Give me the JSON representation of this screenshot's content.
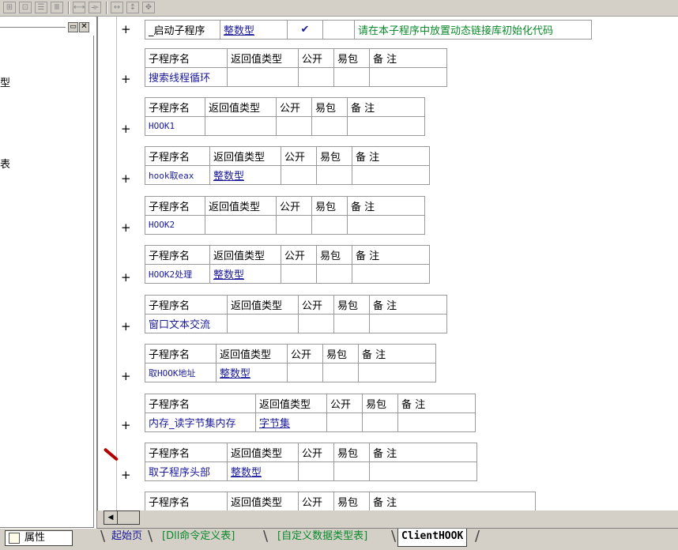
{
  "toolbar": {
    "icons": [
      "grid-split-icon",
      "grid-center-icon",
      "insert-row-icon",
      "insert-col-icon",
      "align-h-icon",
      "align-v-icon",
      "expand-h-icon",
      "expand-v-icon",
      "move-icon"
    ]
  },
  "left_panel": {
    "fragments": [
      "型",
      "表"
    ],
    "properties_tab_label": "属性"
  },
  "headers": {
    "name": "子程序名",
    "return_type": "返回值类型",
    "public": "公开",
    "easy_pkg": "易包",
    "remark": "备 注"
  },
  "first_row": {
    "name": "_启动子程序",
    "return_type": "整数型",
    "public_mark": "✔",
    "remark": "请在本子程序中放置动态链接库初始化代码"
  },
  "subroutines": [
    {
      "name": "搜索线程循环",
      "return_type": ""
    },
    {
      "name": "HOOK1",
      "return_type": ""
    },
    {
      "name": "hook取eax",
      "return_type": "整数型"
    },
    {
      "name": "HOOK2",
      "return_type": ""
    },
    {
      "name": "HOOK2处理",
      "return_type": "整数型"
    },
    {
      "name": "窗口文本交流",
      "return_type": ""
    },
    {
      "name": "取HOOK地址",
      "return_type": "整数型"
    },
    {
      "name": "内存_读字节集内存",
      "return_type": "字节集"
    },
    {
      "name": "取子程序头部",
      "return_type": "整数型"
    }
  ],
  "expand_symbol": "+",
  "tabs": {
    "start_page": "起始页",
    "dll_table": "[Dll命令定义表]",
    "type_table": "[自定义数据类型表]",
    "active": "ClientHOOK"
  },
  "colors": {
    "link_blue": "#1a1a9a",
    "remark_green": "#0a8a2a",
    "check_red": "#c00000",
    "chrome_gray": "#d4d0c8"
  }
}
